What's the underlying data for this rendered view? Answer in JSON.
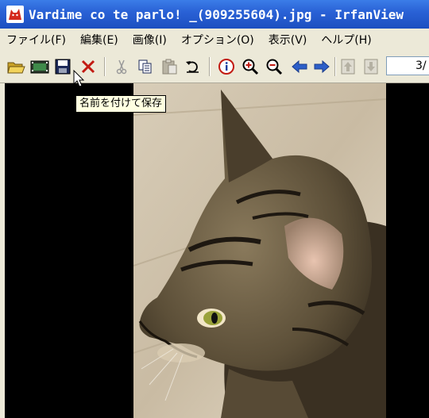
{
  "window": {
    "title": "Vardime co te parlo! _(909255604).jpg - IrfanView",
    "app_icon": "irfanview-red-cat-logo"
  },
  "menu": {
    "items": [
      {
        "label": "ファイル(F)"
      },
      {
        "label": "編集(E)"
      },
      {
        "label": "画像(I)"
      },
      {
        "label": "オプション(O)"
      },
      {
        "label": "表示(V)"
      },
      {
        "label": "ヘルプ(H)"
      }
    ]
  },
  "toolbar": {
    "buttons": [
      {
        "name": "open-folder-icon"
      },
      {
        "name": "slideshow-icon"
      },
      {
        "name": "save-icon"
      },
      {
        "name": "delete-icon"
      },
      {
        "name": "cut-icon"
      },
      {
        "name": "copy-icon"
      },
      {
        "name": "paste-icon"
      },
      {
        "name": "undo-icon"
      },
      {
        "name": "info-icon"
      },
      {
        "name": "zoom-in-icon"
      },
      {
        "name": "zoom-out-icon"
      },
      {
        "name": "previous-arrow-icon"
      },
      {
        "name": "next-arrow-icon"
      },
      {
        "name": "first-file-icon"
      },
      {
        "name": "last-file-icon"
      }
    ],
    "page_counter": "3/"
  },
  "tooltip": {
    "text": "名前を付けて保存"
  },
  "colors": {
    "titlebar": "#2a62d6",
    "chrome": "#ece9d8",
    "tooltip_bg": "#ffffe1"
  }
}
